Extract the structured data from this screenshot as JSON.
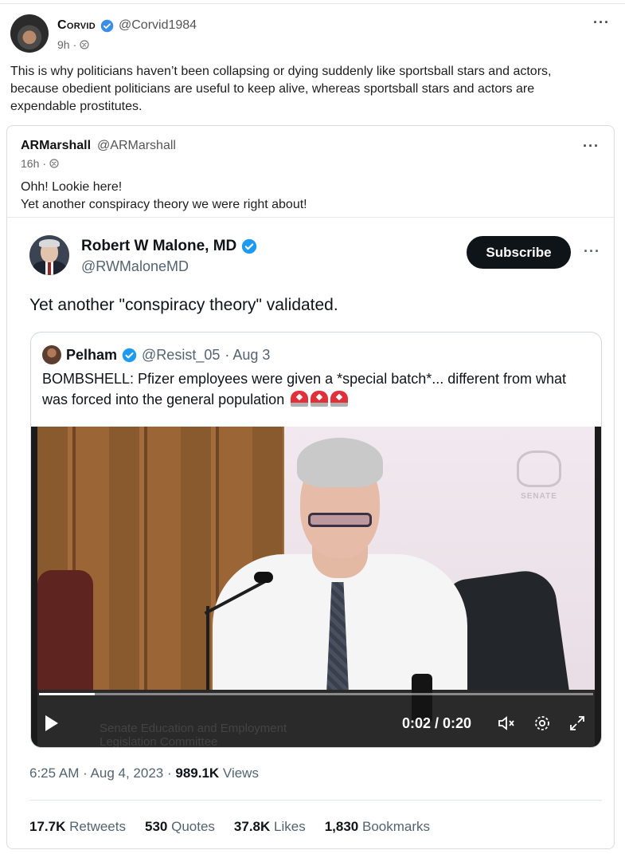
{
  "post": {
    "author_name": "Corvid",
    "author_handle": "@Corvid1984",
    "time": "9h",
    "text": "This is why politicians haven’t been collapsing or dying suddenly like sportsball stars and actors, because obedient politicians are useful to keep alive, whereas sportsball stars and actors are expendable prostitutes.",
    "more_icon": "···"
  },
  "quoted": {
    "author_name": "ARMarshall",
    "author_handle": "@ARMarshall",
    "time": "16h",
    "line1": "Ohh! Lookie here!",
    "line2": "Yet another conspiracy theory we were right about!",
    "more_icon": "···"
  },
  "embedded_tweet": {
    "name": "Robert W Malone, MD",
    "handle": "@RWMaloneMD",
    "subscribe_label": "Subscribe",
    "more_icon": "···",
    "text": "Yet another \"conspiracy theory\" validated.",
    "inner_quote": {
      "name": "Pelham",
      "handle": "@Resist_05",
      "date": "· Aug 3",
      "text": "BOMBSHELL: Pfizer employees were given a *special batch*... different from what was forced into the general population"
    },
    "video": {
      "time_display": "0:02 / 0:20",
      "progress": 0.1,
      "crest_label": "SENATE",
      "caption_line1": "Senate Education and Employment",
      "caption_line2": "Legislation Committee"
    },
    "timestamp": "6:25 AM · Aug 4, 2023 ·",
    "views_count": "989.1K",
    "views_label": "Views",
    "stats": [
      {
        "count": "17.7K",
        "label": "Retweets"
      },
      {
        "count": "530",
        "label": "Quotes"
      },
      {
        "count": "37.8K",
        "label": "Likes"
      },
      {
        "count": "1,830",
        "label": "Bookmarks"
      }
    ]
  },
  "colors": {
    "verified": "#1d9bf0",
    "text_secondary": "#536471",
    "siren": "#e0303a"
  }
}
